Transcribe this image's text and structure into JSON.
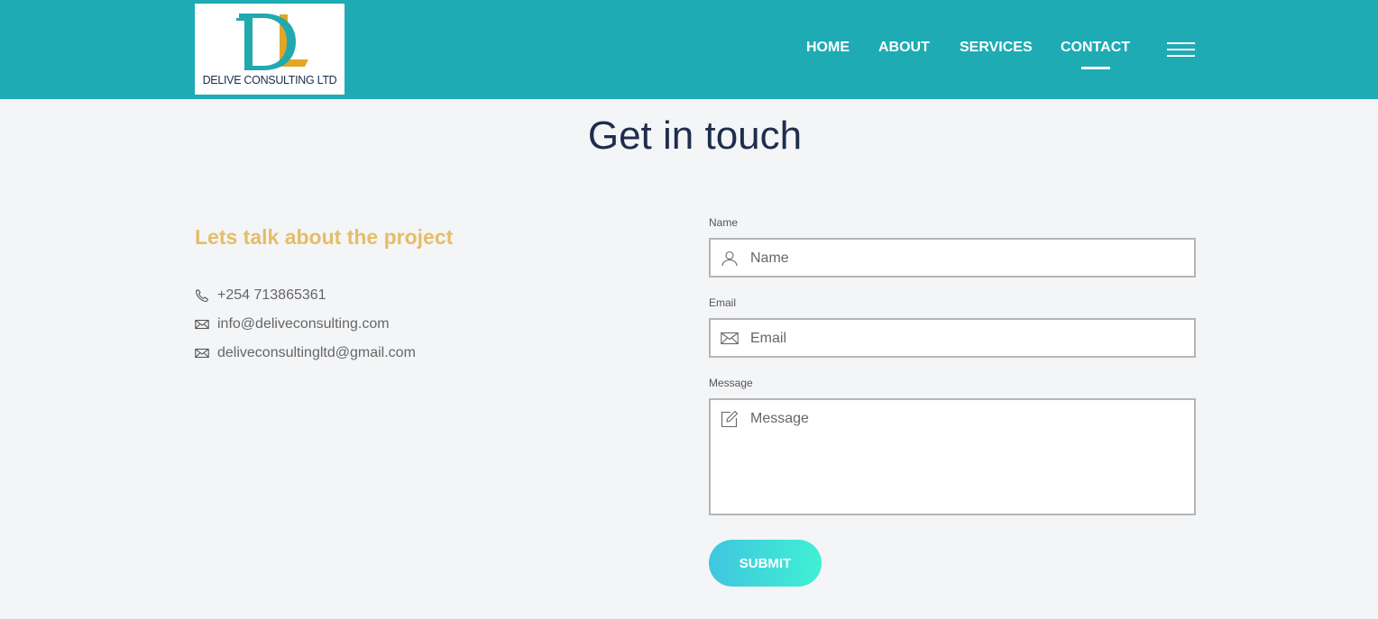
{
  "header": {
    "logo_text": "DELIVE CONSULTING LTD",
    "nav": [
      "HOME",
      "ABOUT",
      "SERVICES",
      "CONTACT"
    ],
    "active_nav": "CONTACT",
    "menu_icon": "hamburger-menu-icon"
  },
  "main": {
    "title": "Get in touch",
    "subtitle": "Lets talk about the project",
    "contacts": [
      {
        "icon": "phone-icon",
        "text": "+254 713865361"
      },
      {
        "icon": "envelope-icon",
        "text": "info@deliveconsulting.com"
      },
      {
        "icon": "envelope-icon",
        "text": "deliveconsultingltd@gmail.com"
      }
    ]
  },
  "form": {
    "name_label": "Name",
    "name_placeholder": "Name",
    "email_label": "Email",
    "email_placeholder": "Email",
    "message_label": "Message",
    "message_placeholder": "Message",
    "submit_label": "SUBMIT"
  },
  "colors": {
    "header_bg": "#1eabb4",
    "accent_gold": "#e5bd67",
    "title_navy": "#1f2d4d",
    "button_gradient_start": "#3fc6df",
    "button_gradient_end": "#3ff0d3"
  }
}
